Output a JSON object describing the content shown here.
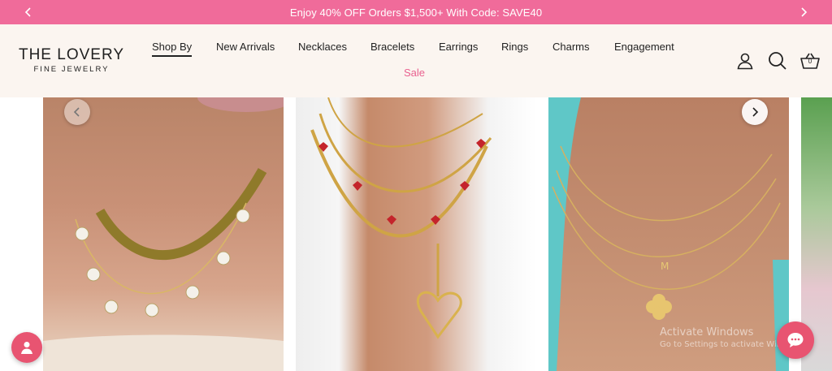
{
  "promo": {
    "text": "Enjoy 40% OFF Orders $1,500+ With Code: SAVE40",
    "prev_icon": "chevron-left-icon",
    "next_icon": "chevron-right-icon"
  },
  "brand": {
    "line1": "THE LOVERY",
    "line2": "FINE JEWELRY"
  },
  "nav": {
    "items": [
      "Shop By",
      "New Arrivals",
      "Necklaces",
      "Bracelets",
      "Earrings",
      "Rings",
      "Charms",
      "Engagement"
    ],
    "active": "Shop By",
    "sale": "Sale"
  },
  "header_icons": {
    "account": "user-icon",
    "search": "search-icon",
    "cart": "basket-icon",
    "cart_count": "0"
  },
  "watermark": {
    "line1": "Activate Windows",
    "line2": "Go to Settings to activate Windows."
  },
  "colors": {
    "promo_bg": "#f06b9a",
    "header_bg": "#fbf5f0",
    "sale": "#e9618f",
    "fab": "#e85471"
  }
}
